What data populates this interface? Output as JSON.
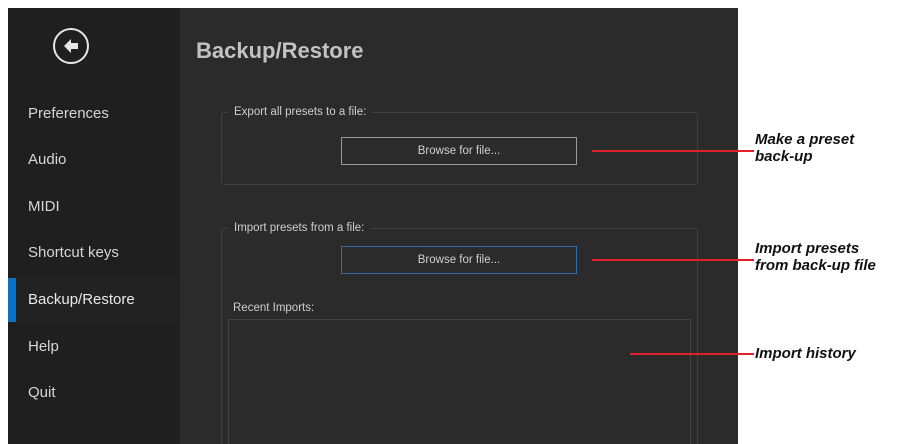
{
  "page": {
    "title": "Backup/Restore"
  },
  "sidebar": {
    "back_icon": "arrow-left-circle-icon",
    "items": [
      {
        "label": "Preferences"
      },
      {
        "label": "Audio"
      },
      {
        "label": "MIDI"
      },
      {
        "label": "Shortcut keys"
      },
      {
        "label": "Backup/Restore",
        "active": true
      },
      {
        "label": "Help"
      },
      {
        "label": "Quit"
      }
    ]
  },
  "export": {
    "label": "Export all presets to a file:",
    "button": "Browse for file..."
  },
  "import": {
    "label": "Import presets from a file:",
    "button": "Browse for file...",
    "recent_label": "Recent Imports:"
  },
  "callouts": {
    "make_backup": [
      "Make a preset",
      "back-up"
    ],
    "import_presets": [
      "Import presets",
      "from back-up file"
    ],
    "import_history": [
      "Import history"
    ]
  },
  "colors": {
    "accent": "#0a73c9",
    "callout_line": "#e1212b"
  }
}
